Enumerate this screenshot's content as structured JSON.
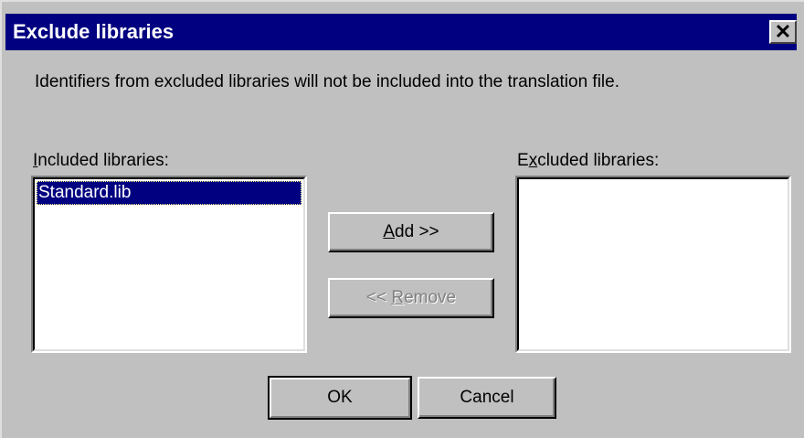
{
  "window": {
    "title": "Exclude libraries",
    "close_glyph": "✕"
  },
  "description": "Identifiers from excluded libraries will not be included into the translation file.",
  "included": {
    "label_mnemonic": "I",
    "label_rest": "ncluded libraries:",
    "items": [
      "Standard.lib"
    ],
    "selected_index": 0
  },
  "excluded": {
    "label_prefix": "E",
    "label_mnemonic": "x",
    "label_rest": "cluded libraries:",
    "items": []
  },
  "buttons": {
    "add_mnemonic": "A",
    "add_rest": "dd >>",
    "remove_prefix": "<< ",
    "remove_mnemonic": "R",
    "remove_rest": "emove",
    "ok": "OK",
    "cancel": "Cancel"
  },
  "colors": {
    "titlebar": "#000080",
    "face": "#c0c0c0",
    "selection": "#000080"
  }
}
